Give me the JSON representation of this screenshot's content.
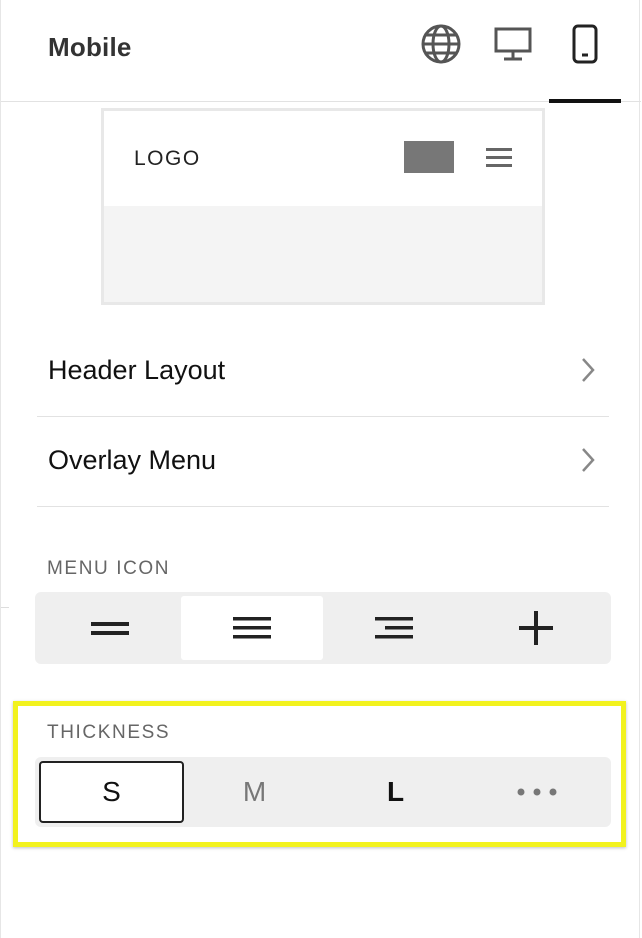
{
  "header": {
    "title": "Mobile",
    "views": [
      {
        "name": "globe-icon",
        "active": false
      },
      {
        "name": "desktop-icon",
        "active": false
      },
      {
        "name": "mobile-icon",
        "active": true
      }
    ]
  },
  "preview": {
    "logo_text": "LOGO"
  },
  "rows": {
    "header_layout": "Header Layout",
    "overlay_menu": "Overlay Menu"
  },
  "menu_icon": {
    "label": "MENU ICON",
    "options": [
      "double-line-icon",
      "triple-line-icon",
      "right-aligned-lines-icon",
      "plus-icon"
    ],
    "selected_index": 1
  },
  "thickness": {
    "label": "THICKNESS",
    "options": [
      "S",
      "M",
      "L",
      "more-options-icon"
    ],
    "selected_index": 0
  },
  "colors": {
    "highlight": "#f2f21e",
    "active_underline": "#111111",
    "preview_button": "#777777"
  }
}
